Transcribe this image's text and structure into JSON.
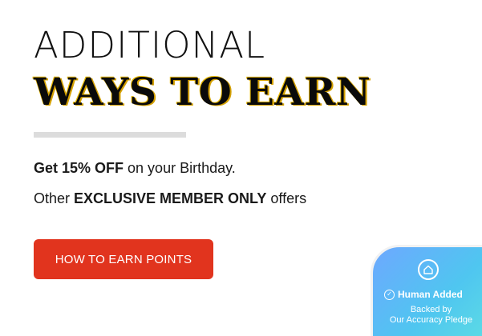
{
  "hero": {
    "heading_line_1": "ADDITIONAL",
    "heading_line_2": "WAYS TO EARN"
  },
  "perks": {
    "line_1_bold": "Get 15% OFF",
    "line_1_rest": " on your Birthday.",
    "line_2_start": "Other ",
    "line_2_bold": "EXCLUSIVE MEMBER ONLY",
    "line_2_rest": " offers"
  },
  "cta": {
    "label": "HOW TO EARN POINTS"
  },
  "trust_badge": {
    "icon": "home-icon",
    "check_icon": "check-circle-icon",
    "title": "Human Added",
    "subtitle_line_1": "Backed by",
    "subtitle_line_2": "Our Accuracy Pledge"
  },
  "colors": {
    "cta_background": "#e1341e",
    "divider": "#dcdcdc",
    "badge_gradient_start": "#6ea8ff",
    "badge_gradient_end": "#5fe0e2"
  }
}
